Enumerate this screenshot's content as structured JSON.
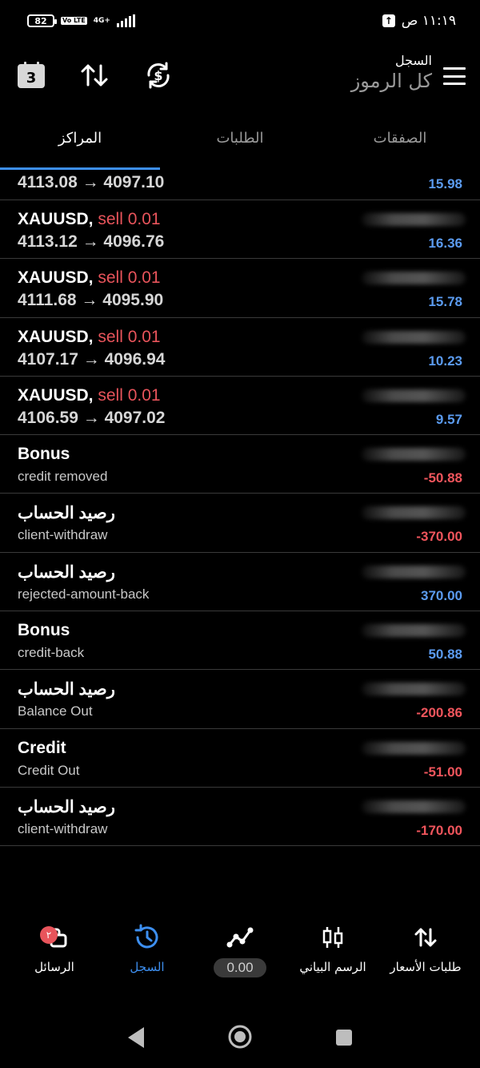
{
  "status_bar": {
    "battery": "82",
    "volte": "Vo LTE",
    "network": "4G+",
    "time": "١١:١٩ ص"
  },
  "header": {
    "calendar_day": "3",
    "section_label": "السجل",
    "filter_label": "كل الرموز"
  },
  "tabs": [
    {
      "label": "المراكز",
      "active": true
    },
    {
      "label": "الطلبات",
      "active": false
    },
    {
      "label": "الصفقات",
      "active": false
    }
  ],
  "rows": [
    {
      "partial": true,
      "symbol": "",
      "side": "",
      "line2": "4113.08 → 4097.10",
      "amount": "15.98",
      "positive": true
    },
    {
      "symbol": "XAUUSD,",
      "side": "sell 0.01",
      "line2": "4113.12 → 4096.76",
      "amount": "16.36",
      "positive": true
    },
    {
      "symbol": "XAUUSD,",
      "side": "sell 0.01",
      "line2": "4111.68 → 4095.90",
      "amount": "15.78",
      "positive": true
    },
    {
      "symbol": "XAUUSD,",
      "side": "sell 0.01",
      "line2": "4107.17 → 4096.94",
      "amount": "10.23",
      "positive": true
    },
    {
      "symbol": "XAUUSD,",
      "side": "sell 0.01",
      "line2": "4106.59 → 4097.02",
      "amount": "9.57",
      "positive": true
    },
    {
      "symbol": "Bonus",
      "side": "",
      "line2": "credit removed",
      "amount": "-50.88",
      "positive": false
    },
    {
      "symbol": "رصيد الحساب",
      "side": "",
      "line2": "client-withdraw",
      "amount": "-370.00",
      "positive": false
    },
    {
      "symbol": "رصيد الحساب",
      "side": "",
      "line2": "rejected-amount-back",
      "amount": "370.00",
      "positive": true
    },
    {
      "symbol": "Bonus",
      "side": "",
      "line2": "credit-back",
      "amount": "50.88",
      "positive": true
    },
    {
      "symbol": "رصيد الحساب",
      "side": "",
      "line2": "Balance Out",
      "amount": "-200.86",
      "positive": false
    },
    {
      "symbol": "Credit",
      "side": "",
      "line2": "Credit Out",
      "amount": "-51.00",
      "positive": false
    },
    {
      "symbol": "رصيد الحساب",
      "side": "",
      "line2": "client-withdraw",
      "amount": "-170.00",
      "positive": false
    }
  ],
  "bottom_nav": {
    "messages": {
      "label": "الرسائل",
      "badge": "٢"
    },
    "history": {
      "label": "السجل"
    },
    "balance": {
      "value": "0.00"
    },
    "chart": {
      "label": "الرسم البياني"
    },
    "quotes": {
      "label": "طلبات الأسعار"
    }
  },
  "colors": {
    "accent": "#3d8ff0",
    "positive": "#5b9bf0",
    "negative": "#f0555c"
  }
}
